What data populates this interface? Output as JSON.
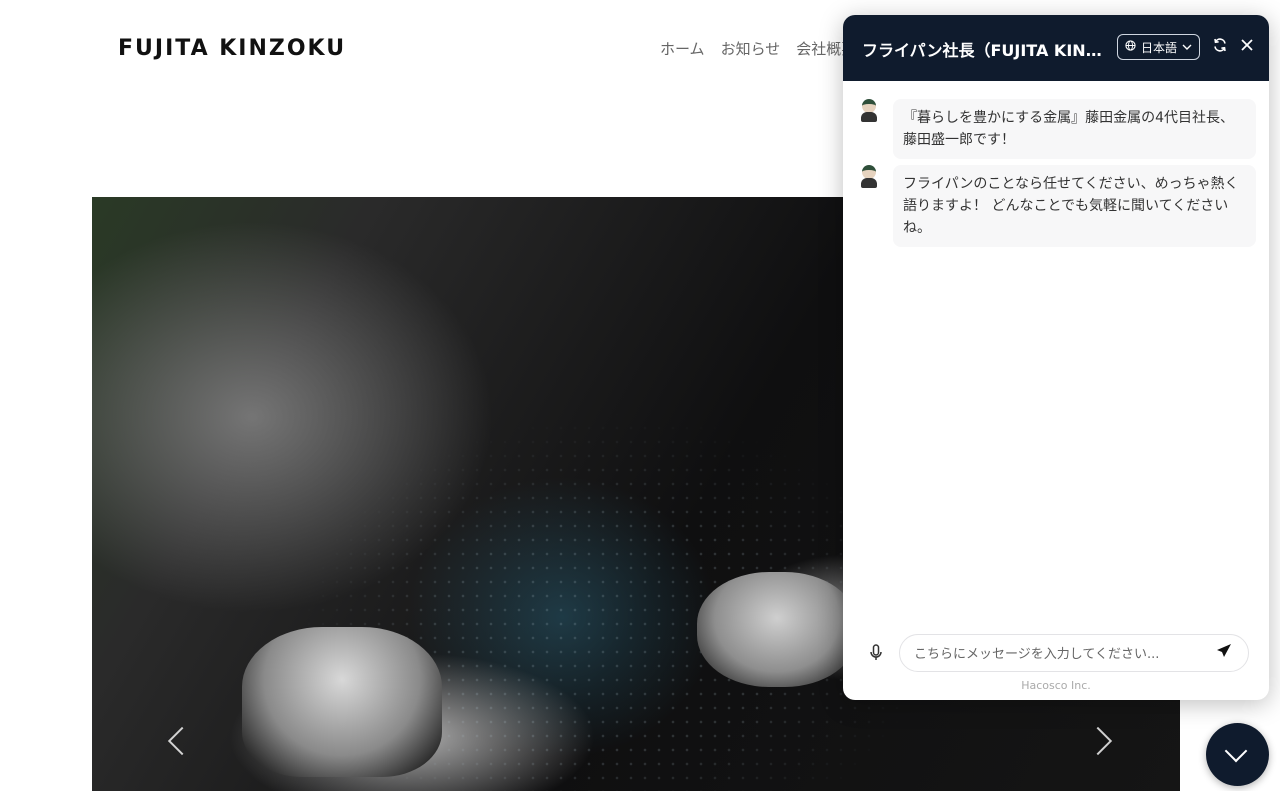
{
  "site": {
    "logo": "FUJITA KINZOKU",
    "nav": [
      "ホーム",
      "お知らせ",
      "会社概要"
    ]
  },
  "hero": {
    "image": "metal-bolts-and-shavings-photo",
    "prev_icon": "chevron-left-icon",
    "next_icon": "chevron-right-icon"
  },
  "chat": {
    "title": "フライパン社長（FUJITA KINZOKU）",
    "language": "日本語",
    "messages": [
      "『暮らしを豊かにする金属』藤田金属の4代目社長、藤田盛一郎です！",
      "フライパンのことなら任せてください、めっちゃ熱く語りますよ！ どんなことでも気軽に聞いてくださいね。"
    ],
    "input_placeholder": "こちらにメッセージを入力してください...",
    "footer": "Hacosco Inc.",
    "colors": {
      "header_bg": "#0f1b2d",
      "bubble_bg": "#f7f7f8"
    }
  }
}
